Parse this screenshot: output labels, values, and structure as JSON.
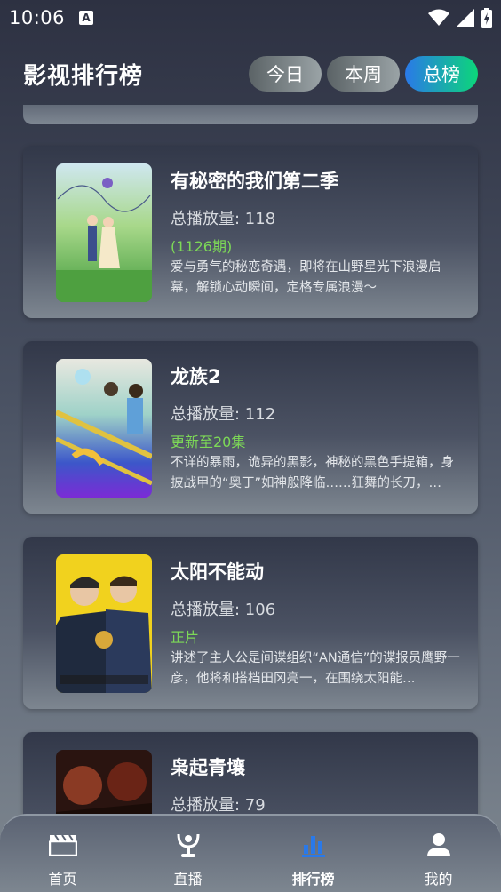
{
  "status": {
    "time": "10:06",
    "notif_glyph": "A"
  },
  "header": {
    "title": "影视排行榜",
    "tabs": [
      {
        "label": "今日",
        "active": false
      },
      {
        "label": "本周",
        "active": false
      },
      {
        "label": "总榜",
        "active": true
      }
    ]
  },
  "items": [
    {
      "title": "有秘密的我们第二季",
      "plays": "总播放量: 118",
      "status": "(1126期)",
      "desc": "爱与勇气的秘恋奇遇，即将在山野星光下浪漫启幕，解锁心动瞬间，定格专属浪漫～",
      "poster": "poster-romance"
    },
    {
      "title": "龙族2",
      "plays": "总播放量: 112",
      "status": "更新至20集",
      "desc": "不详的暴雨，诡异的黑影，神秘的黑色手提箱，身披战甲的“奥丁”如神般降临……狂舞的长刀，…",
      "poster": "poster-anime"
    },
    {
      "title": "太阳不能动",
      "plays": "总播放量: 106",
      "status": "正片",
      "desc": "讲述了主人公是间谍组织“AN通信”的谍报员鹰野一彦，他将和搭档田冈亮一，在围绕太阳能…",
      "poster": "poster-drama"
    },
    {
      "title": "枭起青壤",
      "plays": "总播放量: 79",
      "status": "",
      "desc": "",
      "poster": "poster-dark"
    }
  ],
  "nav": [
    {
      "label": "首页",
      "icon": "clapperboard-icon",
      "active": false
    },
    {
      "label": "直播",
      "icon": "live-icon",
      "active": false
    },
    {
      "label": "排行榜",
      "icon": "ranking-icon",
      "active": true
    },
    {
      "label": "我的",
      "icon": "profile-icon",
      "active": false
    }
  ],
  "colors": {
    "accent_blue": "#2a79e8",
    "accent_green": "#0cd67a",
    "status_green": "#7dd957"
  }
}
